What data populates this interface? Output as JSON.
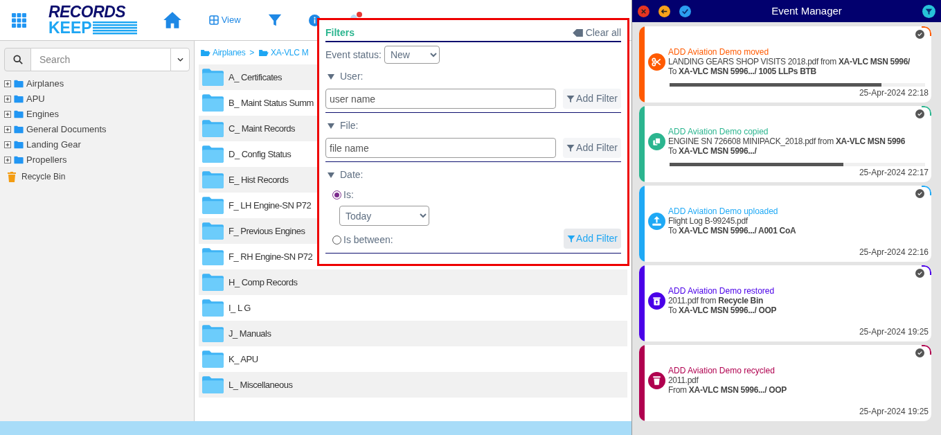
{
  "header": {
    "logo": {
      "line1": "RECORDS",
      "line2": "KEEP"
    },
    "nav": [
      {
        "kind": "home"
      },
      {
        "kind": "view",
        "label": "View"
      },
      {
        "kind": "filter"
      },
      {
        "kind": "info"
      },
      {
        "kind": "bell",
        "badge": true
      }
    ]
  },
  "sidebar": {
    "search": {
      "placeholder": "Search"
    },
    "tree": [
      {
        "label": "Airplanes",
        "expanded": false
      },
      {
        "label": "APU",
        "expanded": false
      },
      {
        "label": "Engines",
        "expanded": false
      },
      {
        "label": "General Documents",
        "expanded": false
      },
      {
        "label": "Landing Gear",
        "expanded": false
      },
      {
        "label": "Propellers",
        "expanded": false
      }
    ],
    "recycle_bin": "Recycle Bin"
  },
  "breadcrumb": [
    "Airplanes",
    "XA-VLC M"
  ],
  "breadcrumb_separator": ">",
  "folders": [
    "A_ Certificates",
    "B_ Maint Status Summ",
    "C_ Maint Records",
    "D_ Config Status",
    "E_ Hist Records",
    "F_ LH Engine-SN P72",
    "F_ Previous Engines",
    "F_ RH Engine-SN P72",
    "H_ Comp Records",
    "I_ L G",
    "J_ Manuals",
    "K_ APU",
    "L_ Miscellaneous"
  ],
  "filters": {
    "title": "Filters",
    "clear_all": "Clear all",
    "event_status": {
      "label": "Event status:",
      "value": "New"
    },
    "user": {
      "label": "User:",
      "expanded": true,
      "placeholder": "user name",
      "button": "Add Filter"
    },
    "file": {
      "label": "File:",
      "expanded": true,
      "placeholder": "file name",
      "button": "Add Filter"
    },
    "date": {
      "label": "Date:",
      "expanded": true,
      "options": [
        {
          "label": "Is:",
          "selected": true
        },
        {
          "label": "Is between:",
          "selected": false
        }
      ],
      "value": "Today",
      "button": "Add Filter"
    }
  },
  "event_manager": {
    "title": "Event Manager",
    "events": [
      {
        "kind": "moved",
        "color": "#ff5a00",
        "title": "ADD Aviation Demo moved",
        "line1": "LANDING GEARS SHOP VISITS 2018.pdf from **XA-VLC MSN 5996/**",
        "line2": "To **XA-VLC MSN 5996.../ 1005 LLPs BTB**",
        "level": 0.83,
        "time": "25-Apr-2024 22:18"
      },
      {
        "kind": "copied",
        "color": "#2bb58f",
        "title": "ADD Aviation Demo copied",
        "line1": "ENGINE SN 726608 MINIPACK_2018.pdf from **XA-VLC MSN 5996**",
        "line2": "To **XA-VLC MSN 5996.../**",
        "level": 0.68,
        "time": "25-Apr-2024 22:17"
      },
      {
        "kind": "uploaded",
        "color": "#1fa9f5",
        "title": "ADD Aviation Demo uploaded",
        "line1": "Flight Log B-99245.pdf",
        "line2": "To **XA-VLC MSN 5996.../ A001 CoA**",
        "time": "25-Apr-2024 22:16"
      },
      {
        "kind": "restored",
        "color": "#4a00e8",
        "title": "ADD Aviation Demo restored",
        "line1": "2011.pdf from **Recycle Bin**",
        "line2": "To **XA-VLC MSN 5996.../ OOP**",
        "time": "25-Apr-2024 19:25"
      },
      {
        "kind": "recycled",
        "color": "#b0004f",
        "title": "ADD Aviation Demo recycled",
        "line1": "2011.pdf",
        "line2": "From **XA-VLC MSN 5996.../ OOP**",
        "time": "25-Apr-2024 19:25"
      }
    ]
  }
}
